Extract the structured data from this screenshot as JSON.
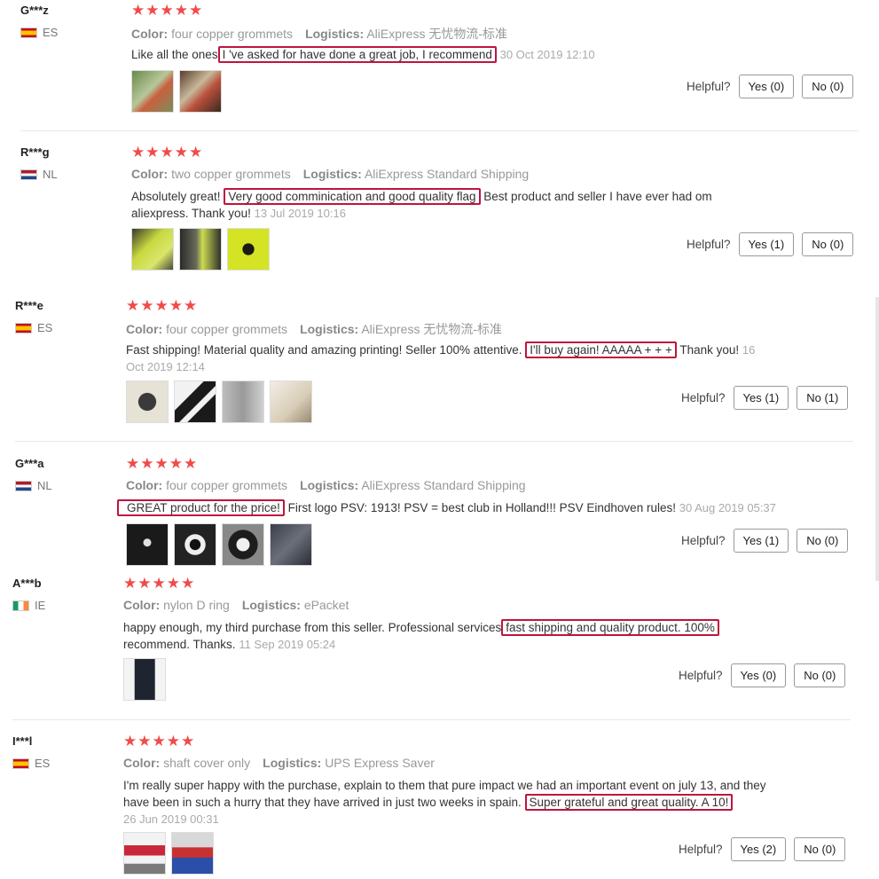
{
  "labels": {
    "color": "Color:",
    "logistics": "Logistics:",
    "helpful": "Helpful?"
  },
  "reviews": [
    {
      "user": "G***z",
      "country": "ES",
      "flag": "es",
      "stars": "★★★★★",
      "color": "four copper grommets",
      "logistics": "AliExpress 无忧物流-标准",
      "pre": "Like all the ones",
      "highlight": "I 've asked for have done a great job, I recommend",
      "post": "",
      "date": "30 Oct 2019 12:10",
      "yes": "Yes (0)",
      "no": "No (0)",
      "photos": [
        "green-flag-photo",
        "flag-photo"
      ]
    },
    {
      "user": "R***g",
      "country": "NL",
      "flag": "nl",
      "stars": "★★★★★",
      "color": "two copper grommets",
      "logistics": "AliExpress Standard Shipping",
      "pre": "Absolutely great!",
      "highlight": "Very good comminication and good quality flag",
      "post": "Best product and seller I have ever had om aliexpress. Thank you!",
      "date": "13 Jul 2019 10:16",
      "yes": "Yes (1)",
      "no": "No (0)",
      "photos": [
        "yellow-flag-photo",
        "flag-pole-photo",
        "yellow-flag-closeup-photo"
      ]
    },
    {
      "user": "R***e",
      "country": "ES",
      "flag": "es",
      "stars": "★★★★★",
      "color": "four copper grommets",
      "logistics": "AliExpress 无忧物流-标准",
      "pre": "Fast shipping! Material quality and amazing printing! Seller 100% attentive.",
      "highlight": "I'll buy again! AAAAA + + +",
      "post": "Thank you!",
      "date": "16 Oct 2019 12:14",
      "yes": "Yes (1)",
      "no": "No (1)",
      "photos": [
        "logo-flag-photo",
        "triangle-logo-photo",
        "vag-flag-photo",
        "flag-wall-photo"
      ]
    },
    {
      "user": "G***a",
      "country": "NL",
      "flag": "nl",
      "stars": "★★★★★",
      "color": "four copper grommets",
      "logistics": "AliExpress Standard Shipping",
      "pre": "",
      "highlight": "GREAT product for the price!",
      "post": "First logo PSV: 1913! PSV = best club in Holland!!! PSV Eindhoven rules!",
      "date": "30 Aug 2019 05:37",
      "yes": "Yes (1)",
      "no": "No (0)",
      "photos": [
        "black-flag-photo",
        "emblem-flag-photo",
        "crest-flag-photo",
        "folded-flag-photo"
      ]
    },
    {
      "user": "A***b",
      "country": "IE",
      "flag": "ie",
      "stars": "★★★★★",
      "color": "nylon D ring",
      "logistics": "ePacket",
      "pre": "happy enough, my third purchase from this seller. Professional services",
      "highlight": "fast shipping and quality product. 100%",
      "post": "recommend. Thanks.",
      "date": "11 Sep 2019 05:24",
      "yes": "Yes (0)",
      "no": "No (0)",
      "photos": [
        "dark-flag-photo"
      ]
    },
    {
      "user": "I***l",
      "country": "ES",
      "flag": "es",
      "stars": "★★★★★",
      "color": "shaft cover only",
      "logistics": "UPS Express Saver",
      "pre": "I'm really super happy with the purchase, explain to them that pure impact we had an important event on july 13, and they have been in such a hurry that they have arrived in just two weeks in spain.",
      "highlight": "Super grateful and great quality. A 10!",
      "post": "",
      "date": "26 Jun 2019 00:31",
      "yes": "Yes (2)",
      "no": "No (0)",
      "photos": [
        "event-banner-photo",
        "arena-photo"
      ]
    }
  ]
}
